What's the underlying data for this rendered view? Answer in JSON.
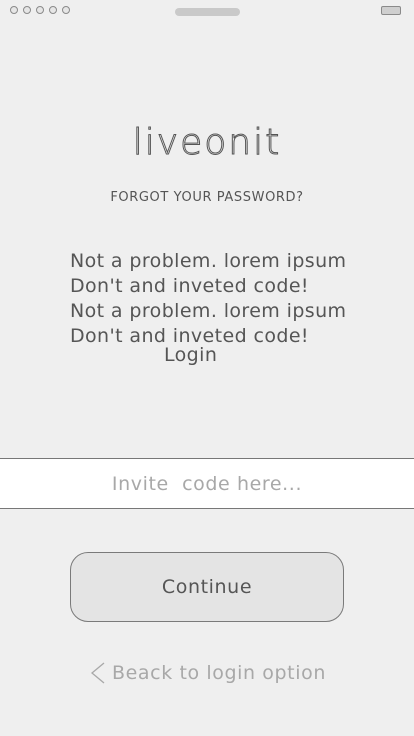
{
  "status_bar": {
    "signal_icon": "signal-dots-icon",
    "battery_icon": "battery-icon"
  },
  "app": {
    "logo_text": "liveonit",
    "subtitle": "FORGOT YOUR PASSWORD?"
  },
  "message": {
    "lines": [
      "Not a problem. lorem ipsum",
      "Don't and inveted code!",
      "Not a problem. lorem ipsum",
      "Don't and inveted code!"
    ],
    "login_label": "Login"
  },
  "invite": {
    "placeholder": "Invite  code here...",
    "value": ""
  },
  "actions": {
    "continue_label": "Continue",
    "back_label": "Beack to login option",
    "back_icon": "chevron-left-icon"
  },
  "colors": {
    "background": "#efefef",
    "text": "#555555",
    "muted_text": "#a8a8a8",
    "button_bg": "#e4e4e4",
    "input_bg": "#ffffff"
  }
}
